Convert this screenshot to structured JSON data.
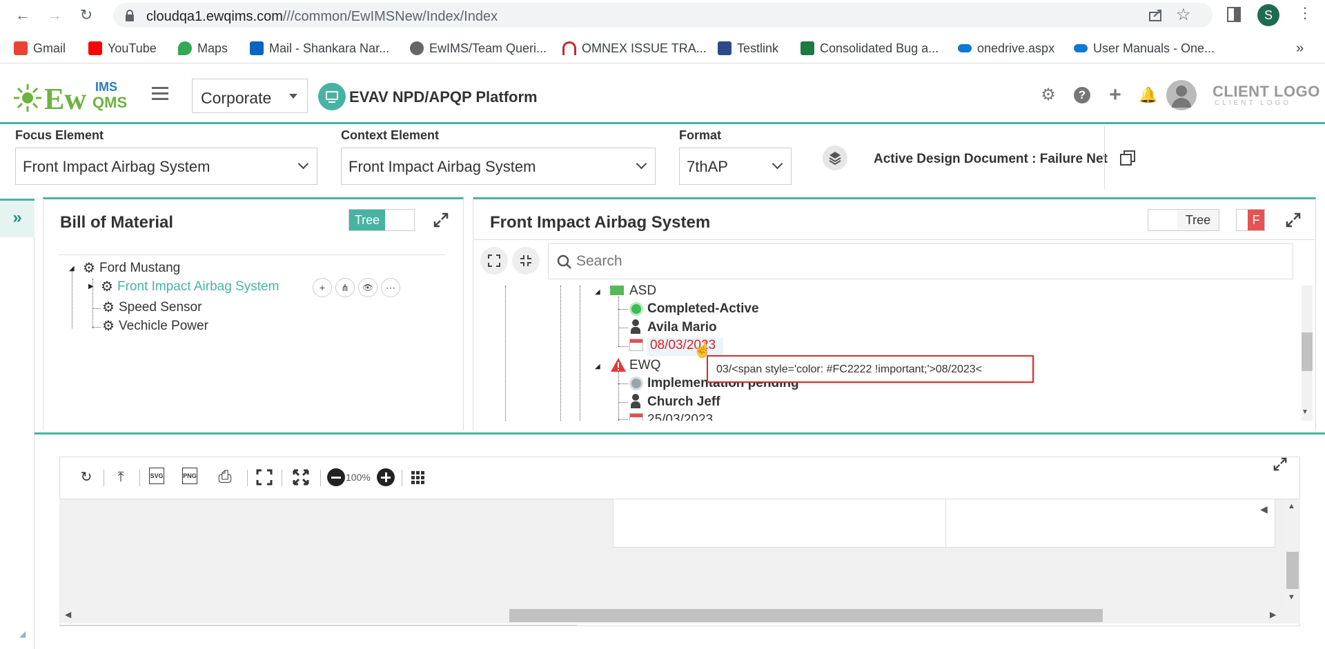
{
  "browser": {
    "url_host": "cloudqa1.ewqims.com",
    "url_path": "///common/EwIMSNew/Index/Index",
    "profile_initial": "S",
    "bookmarks": [
      "Gmail",
      "YouTube",
      "Maps",
      "Mail - Shankara Nar...",
      "EwIMS/Team Queri...",
      "OMNEX ISSUE TRA...",
      "Testlink",
      "Consolidated Bug a...",
      "onedrive.aspx",
      "User Manuals - One..."
    ]
  },
  "header": {
    "logo_text": "Ew",
    "logo_sub_top": "IMS",
    "logo_sub_bottom": "QMS",
    "corporate_select": "Corporate",
    "platform_title": "EVAV NPD/APQP Platform",
    "client_logo": "CLIENT LOGO",
    "client_logo_sub": "CLIENT LOGO"
  },
  "selectors": {
    "focus_label": "Focus Element",
    "focus_value": "Front Impact Airbag System",
    "context_label": "Context Element",
    "context_value": "Front Impact Airbag System",
    "format_label": "Format",
    "format_value": "7thAP",
    "active_doc": "Active Design Document : Failure Net"
  },
  "bom": {
    "title": "Bill of Material",
    "toggle_label": "Tree",
    "nodes": [
      "Ford Mustang",
      "Front Impact Airbag System",
      "Speed Sensor",
      "Vechicle Power"
    ],
    "node_actions": [
      "+",
      "⋔",
      "👁",
      "⋯"
    ]
  },
  "detail": {
    "title": "Front Impact Airbag System",
    "toggle_label": "Tree",
    "toggle2_label": "F",
    "search_placeholder": "Search",
    "nodes": {
      "asd": "ASD",
      "asd_status": "Completed-Active",
      "asd_person": "Avila Mario",
      "asd_date": "08/03/2023",
      "ewq": "EWQ",
      "ewq_status": "Implementation pending",
      "ewq_person": "Church Jeff",
      "ewq_date": "25/03/2023"
    },
    "tooltip": "03/<span style='color: #FC2222 !important;'>08/2023<"
  },
  "diagram": {
    "zoom": "100%",
    "tools": [
      "refresh",
      "upload",
      "svg",
      "png",
      "print",
      "fit",
      "fullscreen",
      "zoom-out",
      "zoom-in",
      "grid"
    ]
  },
  "colors": {
    "accent": "#47b3a3",
    "date_red": "#e02020",
    "tooltip_border": "#d32f2f"
  }
}
